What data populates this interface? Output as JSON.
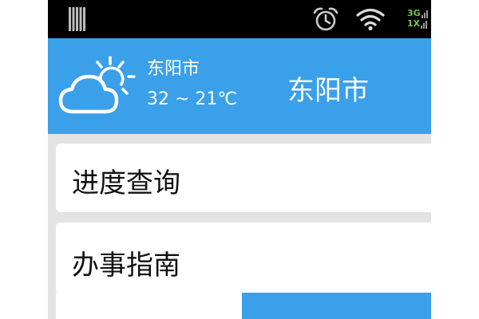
{
  "status_bar": {
    "network_top": "3G",
    "network_bottom": "1X",
    "battery_icon": "battery-icon",
    "alarm_icon": "alarm-clock-icon",
    "wifi_icon": "wifi-icon"
  },
  "header": {
    "weather_icon": "partly-sunny-icon",
    "weather_city": "东阳市",
    "weather_temp": "32 ~ 21℃",
    "title": "东阳市"
  },
  "menu": {
    "items": [
      {
        "label": "进度查询"
      },
      {
        "label": "办事指南"
      }
    ]
  },
  "bottom_buttons": {
    "left_label": "",
    "right_label": ""
  },
  "colors": {
    "accent": "#3aa0ea",
    "status_bar": "#000000",
    "background": "#e3e3e3",
    "card": "#ffffff",
    "network_text": "#7dc242"
  }
}
